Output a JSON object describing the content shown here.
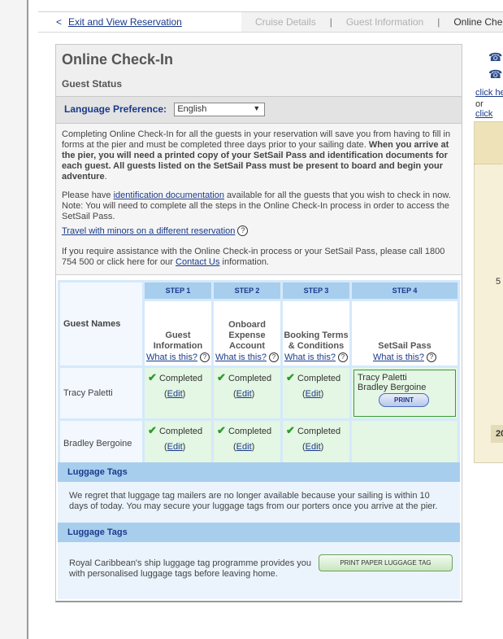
{
  "nav": {
    "back_arrow": "<",
    "back_label": "Exit and View Reservation",
    "steps": [
      "Cruise Details",
      "Guest Information",
      "Online Check"
    ],
    "separator": "|"
  },
  "header": {
    "title": "Online Check-In",
    "subtitle": "Guest Status"
  },
  "language": {
    "label": "Language Preference:",
    "selected": "English"
  },
  "intro": {
    "p1_normal": "Completing Online Check-In for all the guests in your reservation will save you from having to fill in forms at the pier and must be completed three days prior to your sailing date.",
    "p1_bold": "When you arrive at the pier, you will need a printed copy of your SetSail Pass and identification documents for each guest. All guests listed on the SetSail Pass must be present to board and begin your adventure",
    "p1_end": ".",
    "p2_a": "Please have",
    "p2_link": "identification documentation",
    "p2_b": "available for all the guests that you wish to check in now. Note: You will need to complete all the steps in the Online Check-In process in order to access the SetSail Pass.",
    "minors_link": "Travel with minors on a different reservation",
    "p3_a": "If you require assistance with the Online Check-in process or your SetSail Pass, please call 1800 754 500 or click here for our",
    "p3_link": "Contact Us",
    "p3_b": "information."
  },
  "grid": {
    "guest_names_header": "Guest Names",
    "help_link": "What is this?",
    "help_glyph": "?",
    "steps": [
      {
        "num": "STEP 1",
        "title": "Guest Information"
      },
      {
        "num": "STEP 2",
        "title": "Onboard Expense Account"
      },
      {
        "num": "STEP 3",
        "title": "Booking Terms & Conditions"
      },
      {
        "num": "STEP 4",
        "title": "SetSail Pass"
      }
    ],
    "guests": [
      "Tracy Paletti",
      "Bradley Bergoine"
    ],
    "completed_label": "Completed",
    "edit_open": "(",
    "edit_label": "Edit",
    "edit_close": ")",
    "check_glyph": "✔",
    "print_label": "PRINT"
  },
  "luggage1": {
    "title": "Luggage Tags",
    "text": "We regret that luggage tag mailers are no longer available because your sailing is within 10 days of today. You may secure your luggage tags from our porters once you arrive at the pier."
  },
  "luggage2": {
    "title": "Luggage Tags",
    "text": "Royal Caribbean's ship luggage tag programme provides you with personalised luggage tags before leaving home.",
    "button": "PRINT PAPER LUGGAGE TAG"
  },
  "right": {
    "phone_glyph": "☎",
    "link1": "click he",
    "or": "or",
    "link2": "click",
    "num": "5",
    "num2": "20"
  }
}
